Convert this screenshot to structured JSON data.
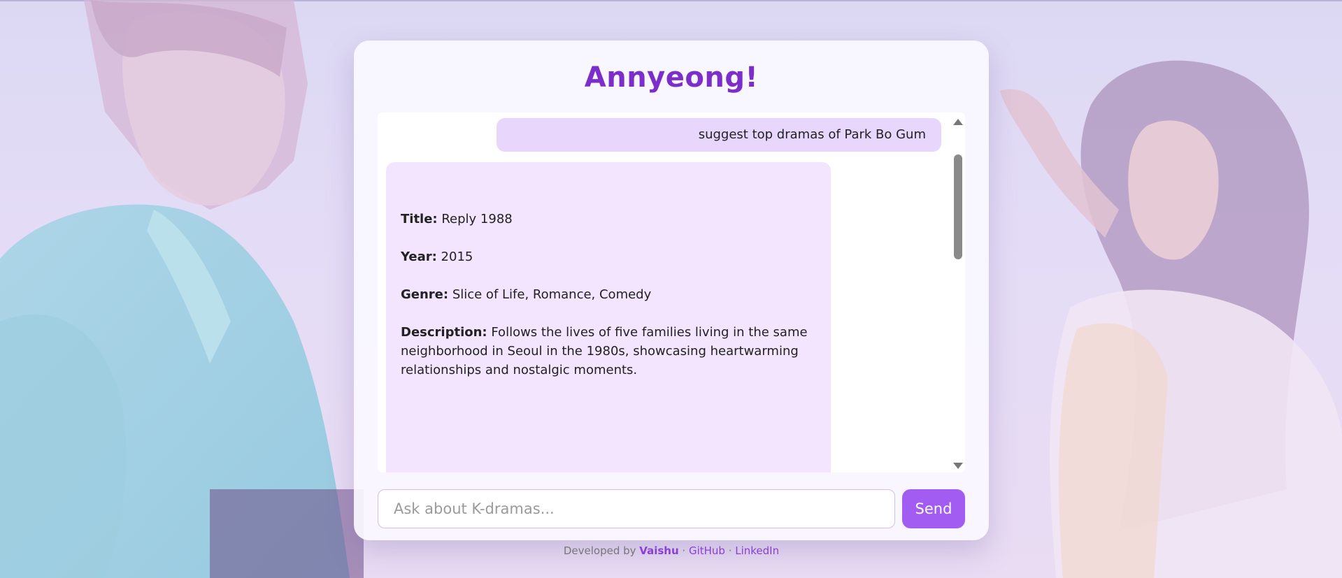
{
  "header": {
    "title": "Annyeong!"
  },
  "chat": {
    "user_message": "suggest top dramas of Park Bo Gum",
    "bot_message": {
      "title_label": "Title:",
      "title_value": " Reply 1988",
      "year_label": "Year:",
      "year_value": " 2015",
      "genre_label": "Genre:",
      "genre_value": " Slice of Life, Romance, Comedy",
      "description_label": "Description:",
      "description_value": " Follows the lives of five families living in the same neighborhood in Seoul in the 1980s, showcasing heartwarming relationships and nostalgic moments."
    }
  },
  "input": {
    "placeholder": "Ask about K-dramas...",
    "value": ""
  },
  "send_button": {
    "label": "Send"
  },
  "footer": {
    "prefix": "Developed by ",
    "author": "Vaishu",
    "sep1": " · ",
    "github": "GitHub",
    "sep2": " · ",
    "linkedin": "LinkedIn"
  },
  "colors": {
    "accent": "#7b2ec9",
    "button": "#a35cf2",
    "user_bubble": "#e8d6fc",
    "bot_bubble": "#f3e5fd"
  },
  "icons": [
    "scroll-up-arrow-icon",
    "scroll-down-arrow-icon"
  ]
}
